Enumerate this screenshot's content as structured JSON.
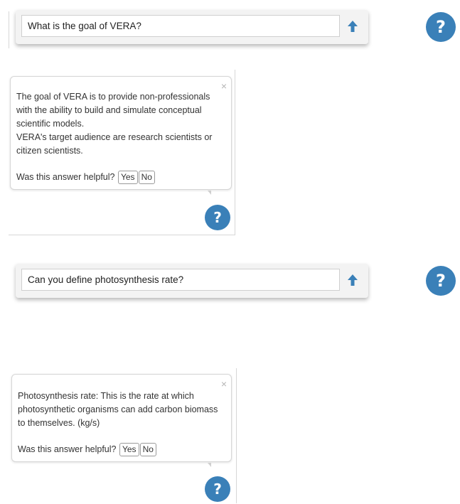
{
  "panel1": {
    "question": "What is the goal of VERA?",
    "send_icon": "arrow-up-icon",
    "help_icon": "question-mark-icon",
    "help_label": "?"
  },
  "answer1": {
    "close_label": "×",
    "lines": [
      "The goal of VERA is to provide non-professionals",
      "with the ability to build and simulate conceptual",
      "scientific models.",
      "VERA's target audience are research scientists or",
      "citizen scientists."
    ],
    "helpful_prompt": "Was this answer helpful?",
    "yes_label": "Yes",
    "no_label": "No",
    "help_label": "?"
  },
  "panel2": {
    "question": "Can you define photosynthesis rate?",
    "send_icon": "arrow-up-icon",
    "help_icon": "question-mark-icon",
    "help_label": "?"
  },
  "answer2": {
    "close_label": "×",
    "lines": [
      "Photosynthesis rate: This is the rate at which",
      "photosynthetic organisms can add carbon biomass",
      "to themselves. (kg/s)"
    ],
    "helpful_prompt": "Was this answer helpful?",
    "yes_label": "Yes",
    "no_label": "No",
    "help_label": "?"
  },
  "colors": {
    "accent": "#3a80b8",
    "bar_background": "#f3f3f3",
    "border": "#d6d6d6"
  }
}
